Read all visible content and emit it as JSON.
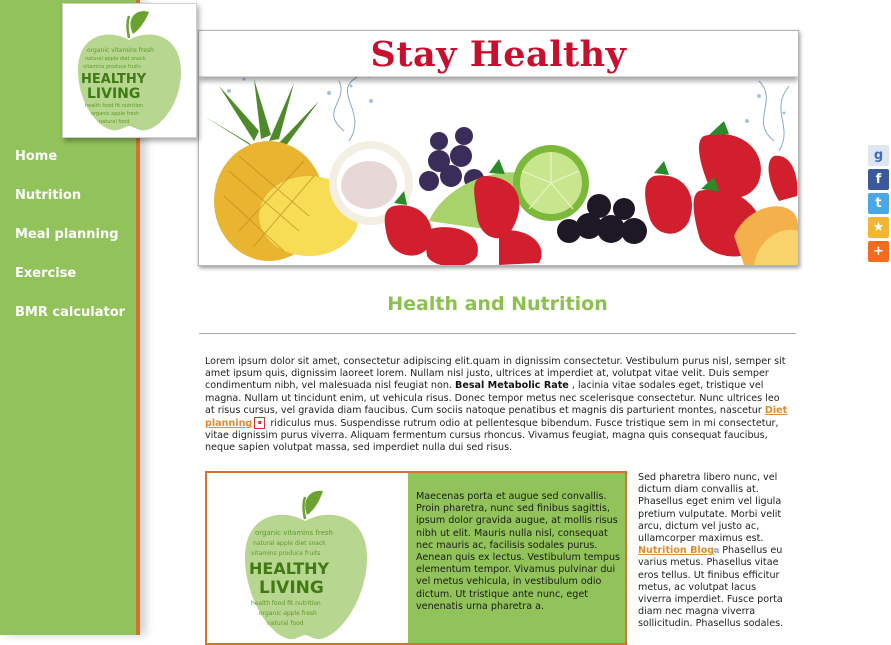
{
  "logo": {
    "words_top": "organic vitamins fresh",
    "word_main_1": "HEALTHY",
    "word_main_2": "LIVING"
  },
  "nav": {
    "items": [
      {
        "label": "Home"
      },
      {
        "label": "Nutrition"
      },
      {
        "label": "Meal planning"
      },
      {
        "label": "Exercise"
      },
      {
        "label": "BMR calculator"
      }
    ]
  },
  "banner": {
    "title": "Stay Healthy"
  },
  "social": {
    "icons": [
      "google-icon",
      "facebook-icon",
      "twitter-icon",
      "favorite-star-icon",
      "add-more-icon"
    ]
  },
  "main": {
    "heading": "Health and Nutrition",
    "intro_part1": "Lorem ipsum dolor sit amet, consectetur adipiscing elit.quam in dignissim consectetur. Vestibulum purus nisl, semper sit amet ipsum quis, dignissim laoreet lorem. Nullam nisl justo, ultrices at imperdiet at, volutpat vitae velit. Duis semper condimentum nibh, vel malesuada nisl feugiat non. ",
    "intro_bold": "Besal Metabolic Rate",
    "intro_part2": " , lacinia vitae sodales eget, tristique vel magna. Nullam ut tincidunt enim, ut vehicula risus. Donec tempor metus nec scelerisque consectetur. Nunc ultrices leo at risus cursus, vel gravida diam faucibus. Cum sociis natoque penatibus et magnis dis parturient montes, nascetur ",
    "intro_link": "Diet planning",
    "intro_part3": " ridiculus mus. Suspendisse rutrum odio at pellentesque bibendum. Fusce tristique sem in mi consectetur, vitae dignissim purus viverra. Aliquam fermentum cursus rhoncus. Vivamus feugiat, magna quis consequat faucibus, neque sapien volutpat massa, sed imperdiet nulla dui sed risus."
  },
  "feature": {
    "text": "Maecenas porta et augue sed convallis. Proin pharetra, nunc sed finibus sagittis, ipsum dolor gravida augue, at mollis risus nibh ut elit. Mauris nulla nisl, consequat nec mauris ac, facilisis sodales purus. Aenean quis ex lectus. Vestibulum tempus elementum tempor. Vivamus pulvinar dui vel metus vehicula, in vestibulum odio dictum. Ut tristique ante nunc, eget venenatis urna pharetra a.",
    "logo_word_1": "HEALTHY",
    "logo_word_2": "LIVING"
  },
  "side": {
    "text1": "Sed pharetra libero nunc, vel dictum diam convallis at. Phasellus eget enim vel ligula pretium vulputate. Morbi velit arcu, dictum vel justo ac, ullamcorper maximus est. ",
    "link": "Nutrition Blog",
    "text2": " Phasellus eu varius metus. Phasellus vitae eros tellus. Ut finibus efficitur metus, ac volutpat lacus viverra imperdiet. Fusce porta diam nec magna viverra sollicitudin. Phasellus sodales."
  }
}
